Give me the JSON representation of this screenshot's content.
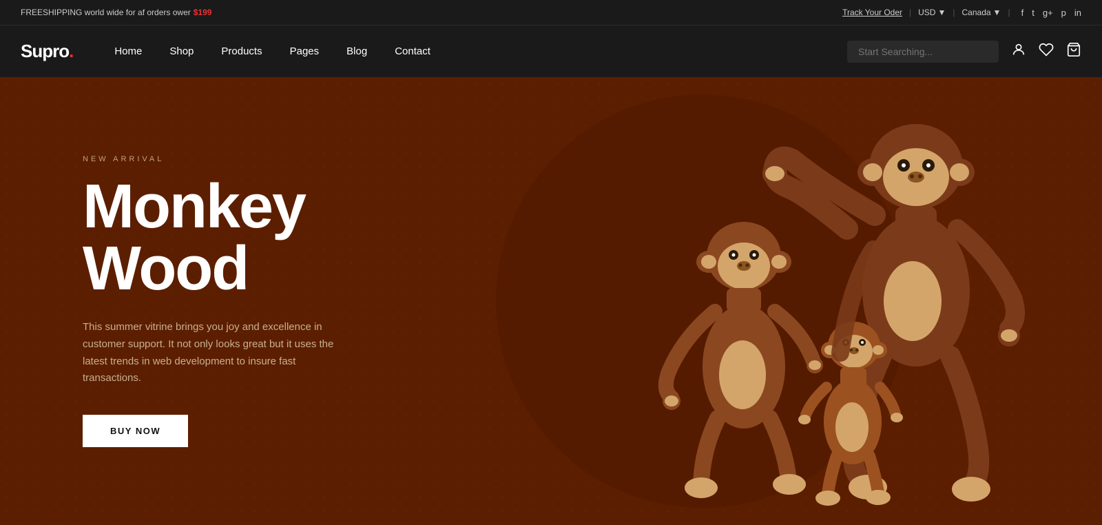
{
  "topbar": {
    "shipping_text": "FREESHIPPING world wide for af orders ower",
    "shipping_price": "$199",
    "track_order": "Track Your Oder",
    "currency": "USD",
    "region": "Canada",
    "social": {
      "facebook": "f",
      "twitter": "t",
      "googleplus": "g+",
      "pinterest": "p",
      "instagram": "in"
    }
  },
  "navbar": {
    "logo": "Supro",
    "logo_dot": ".",
    "links": [
      {
        "label": "Home"
      },
      {
        "label": "Shop"
      },
      {
        "label": "Products"
      },
      {
        "label": "Pages"
      },
      {
        "label": "Blog"
      },
      {
        "label": "Contact"
      }
    ],
    "search_placeholder": "Start Searching..."
  },
  "hero": {
    "subtitle": "NEW ARRIVAL",
    "title_line1": "Monkey",
    "title_line2": "Wood",
    "description": "This summer vitrine brings you joy and excellence in customer support. It not only looks great but it uses the latest trends in web development to insure fast transactions.",
    "cta_label": "BUY NOW"
  },
  "colors": {
    "hero_bg": "#5c1e00",
    "accent_red": "#e63232",
    "logo_white": "#ffffff",
    "nav_bg": "#1a1a1a",
    "topbar_bg": "#1a1a1a"
  }
}
